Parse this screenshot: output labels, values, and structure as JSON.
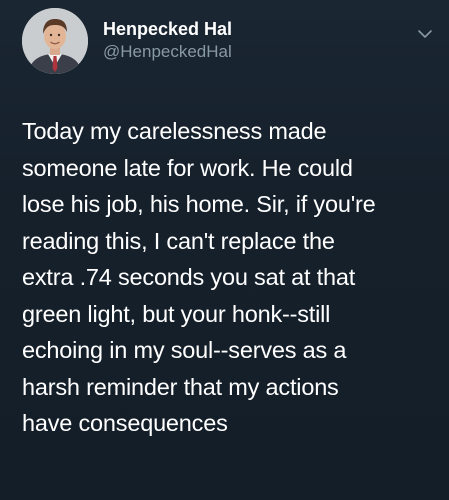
{
  "tweet": {
    "display_name": "Henpecked Hal",
    "handle": "@HenpeckedHal",
    "avatar_icon": "profile-photo-man-in-suit",
    "menu_icon": "chevron-down-icon",
    "text_lines": [
      "Today my carelessness made",
      "someone late for work. He could",
      "lose his job, his home. Sir, if you're",
      "reading this, I can't replace the",
      "extra .74 seconds you sat at that",
      "green light, but your honk--still",
      "echoing in my soul--serves as a",
      "harsh reminder that my actions",
      "have consequences"
    ]
  },
  "colors": {
    "background": "#15202b",
    "primary_text": "#ffffff",
    "secondary_text": "#8899a6"
  }
}
